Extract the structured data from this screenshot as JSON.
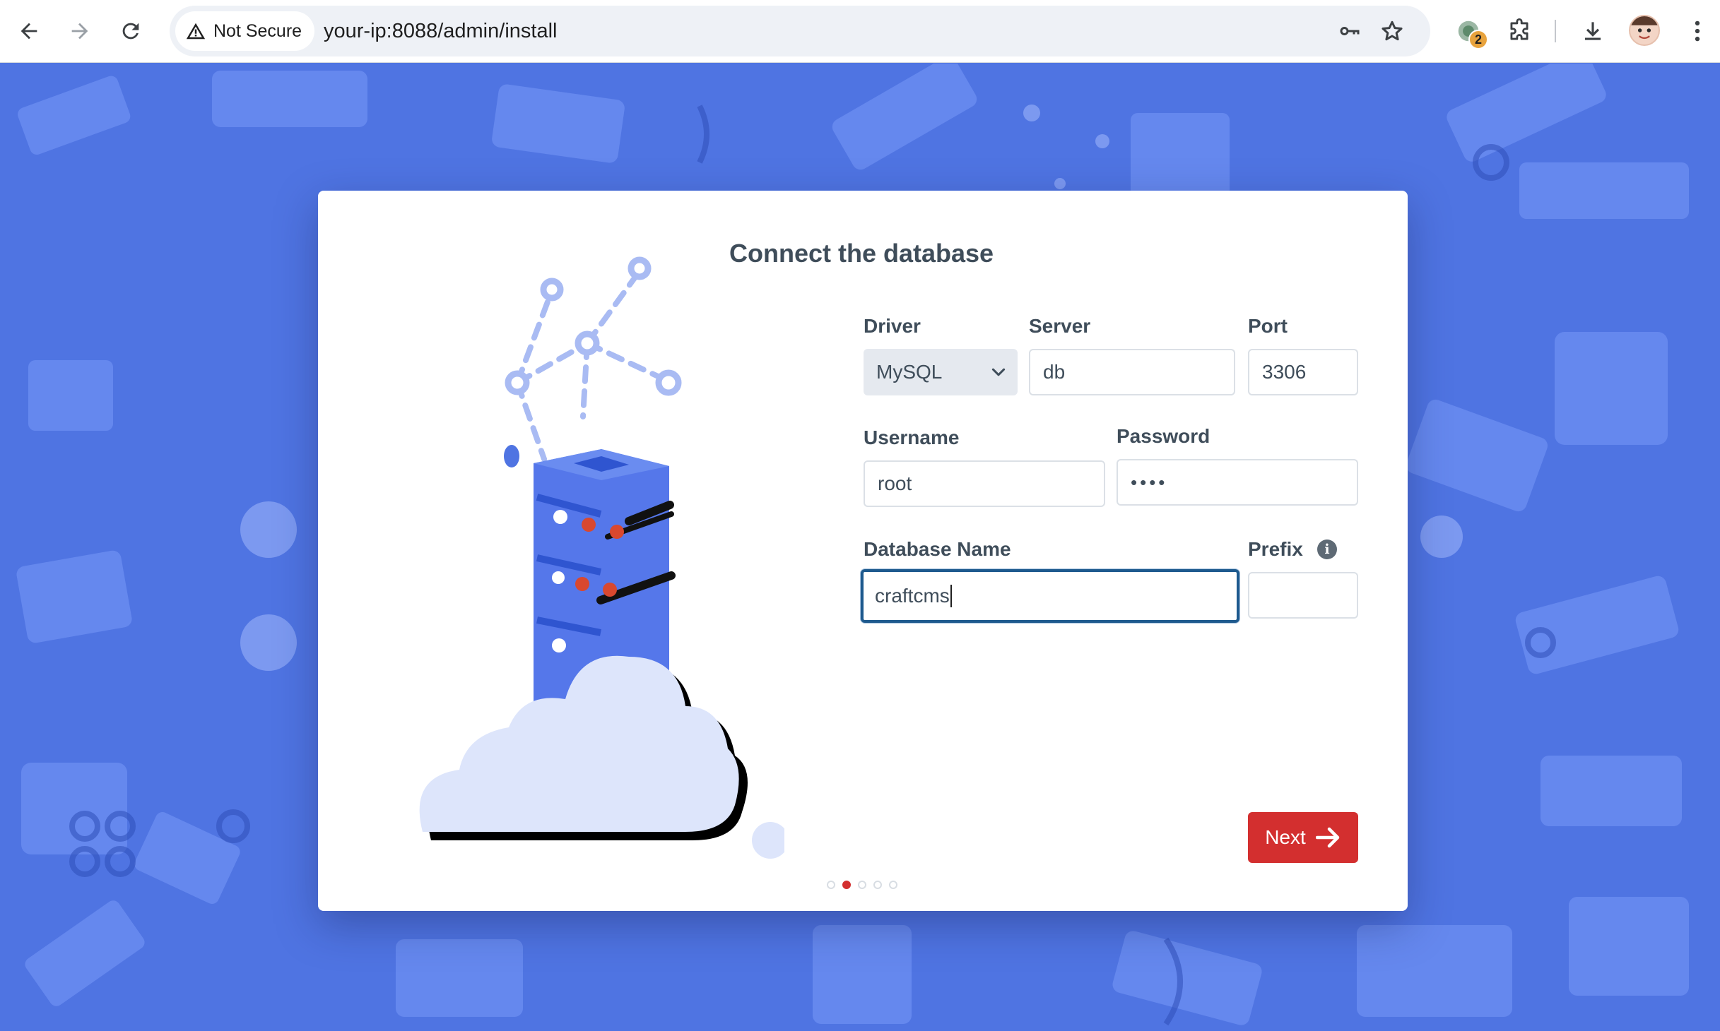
{
  "browser": {
    "security_label": "Not Secure",
    "url": "your-ip:8088/admin/install",
    "extension_badge": "2"
  },
  "form": {
    "title": "Connect the database",
    "driver": {
      "label": "Driver",
      "value": "MySQL"
    },
    "server": {
      "label": "Server",
      "value": "db"
    },
    "port": {
      "label": "Port",
      "value": "3306"
    },
    "username": {
      "label": "Username",
      "value": "root"
    },
    "password": {
      "label": "Password",
      "masked_value": "••••"
    },
    "database_name": {
      "label": "Database Name",
      "value": "craftcms"
    },
    "prefix": {
      "label": "Prefix",
      "value": "",
      "info_glyph": "i"
    },
    "next_label": "Next",
    "steps": {
      "total": 5,
      "current": 2
    }
  },
  "colors": {
    "background": "#4f74e2",
    "accent": "#d32f2f",
    "focus_border": "#1e5a8e",
    "label_text": "#3f4d5a"
  }
}
